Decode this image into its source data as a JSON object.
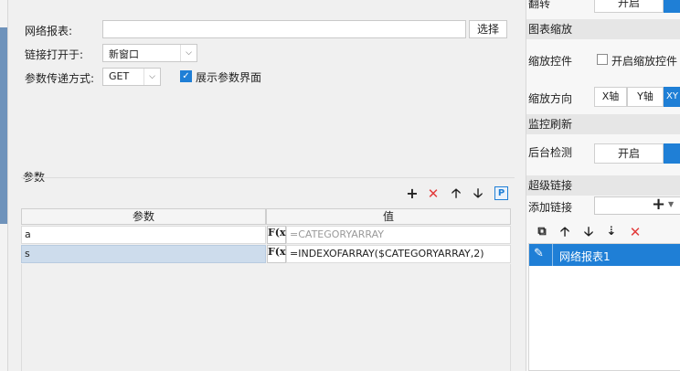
{
  "dialog": {
    "report_label": "网络报表:",
    "report_value": "",
    "select_button": "选择",
    "open_in_label": "链接打开于:",
    "open_in_value": "新窗口",
    "param_method_label": "参数传递方式:",
    "param_method_value": "GET",
    "show_params_label": "展示参数界面",
    "show_params_checked": true,
    "params_group_label": "参数",
    "grid": {
      "headers": [
        "参数",
        "值"
      ],
      "rows": [
        {
          "param": "a",
          "value": "=CATEGORYARRAY",
          "selected": false
        },
        {
          "param": "s",
          "value": "=INDEXOFARRAY($CATEGORYARRAY,2)",
          "selected": true
        }
      ],
      "fx_label": "F(x)"
    }
  },
  "right_panel": {
    "flip_label": "翻转",
    "flip_value": "开启",
    "chart_zoom_section": "图表缩放",
    "zoom_control_label": "缩放控件",
    "zoom_control_check": "开启缩放控件",
    "zoom_control_checked": false,
    "zoom_direction_label": "缩放方向",
    "zoom_dir_x": "X轴",
    "zoom_dir_y": "Y轴",
    "zoom_dir_xy": "XY",
    "monitor_section": "监控刷新",
    "bg_check_label": "后台检测",
    "bg_check_value": "开启",
    "hyperlink_section": "超级链接",
    "add_link_label": "添加链接",
    "add_link_plus": "+",
    "link_items": [
      "网络报表1"
    ]
  },
  "colors": {
    "accent": "#1f7fd6",
    "selected_row": "#cddcec",
    "delete_red": "#e23b3b"
  }
}
